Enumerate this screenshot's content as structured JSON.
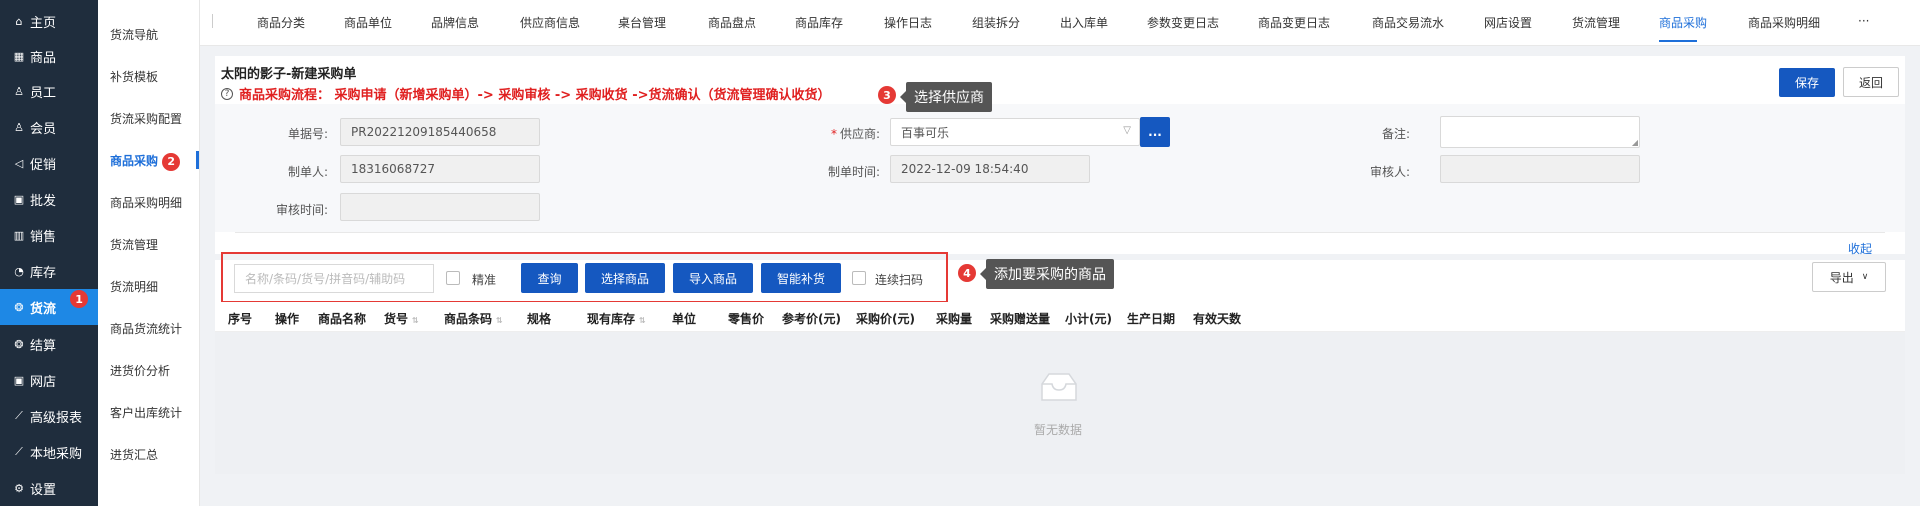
{
  "sidebar": {
    "items": [
      {
        "label": "主页",
        "icon": "home-icon"
      },
      {
        "label": "商品",
        "icon": "product-icon"
      },
      {
        "label": "员工",
        "icon": "staff-icon"
      },
      {
        "label": "会员",
        "icon": "member-icon"
      },
      {
        "label": "促销",
        "icon": "promotion-icon"
      },
      {
        "label": "批发",
        "icon": "wholesale-icon"
      },
      {
        "label": "销售",
        "icon": "sales-icon"
      },
      {
        "label": "库存",
        "icon": "stock-icon"
      },
      {
        "label": "货流",
        "icon": "flow-icon",
        "active": true,
        "badge": "1"
      },
      {
        "label": "结算",
        "icon": "settle-icon"
      },
      {
        "label": "网店",
        "icon": "shop-icon"
      },
      {
        "label": "高级报表",
        "icon": "report-icon"
      },
      {
        "label": "本地采购",
        "icon": "purchase-icon"
      },
      {
        "label": "设置",
        "icon": "settings-icon"
      }
    ]
  },
  "submenu": {
    "items": [
      {
        "label": "货流导航"
      },
      {
        "label": "补货模板"
      },
      {
        "label": "货流采购配置"
      },
      {
        "label": "商品采购",
        "active": true,
        "badge": "2"
      },
      {
        "label": "商品采购明细"
      },
      {
        "label": "货流管理"
      },
      {
        "label": "货流明细"
      },
      {
        "label": "商品货流统计"
      },
      {
        "label": "进货价分析"
      },
      {
        "label": "客户出库统计"
      },
      {
        "label": "进货汇总"
      }
    ]
  },
  "tabs": [
    {
      "label": "商品分类"
    },
    {
      "label": "商品单位"
    },
    {
      "label": "品牌信息"
    },
    {
      "label": "供应商信息"
    },
    {
      "label": "桌台管理"
    },
    {
      "label": "商品盘点"
    },
    {
      "label": "商品库存"
    },
    {
      "label": "操作日志"
    },
    {
      "label": "组装拆分"
    },
    {
      "label": "出入库单"
    },
    {
      "label": "参数变更日志"
    },
    {
      "label": "商品变更日志"
    },
    {
      "label": "商品交易流水"
    },
    {
      "label": "网店设置"
    },
    {
      "label": "货流管理"
    },
    {
      "label": "商品采购",
      "active": true
    },
    {
      "label": "商品采购明细"
    },
    {
      "label": "···"
    }
  ],
  "page": {
    "title": "太阳的影子-新建采购单",
    "flow": "商品采购流程： 采购申请（新增采购单）-> 采购审核 -> 采购收货 ->货流确认（货流管理确认收货）",
    "save": "保存",
    "back": "返回",
    "collapse": "收起",
    "export": "导出"
  },
  "form": {
    "order_no_label": "单据号:",
    "order_no": "PR20221209185440658",
    "supplier_label": "供应商:",
    "supplier": "百事可乐",
    "supplier_btn": "...",
    "remark_label": "备注:",
    "creator_label": "制单人:",
    "creator": "18316068727",
    "create_time_label": "制单时间:",
    "create_time": "2022-12-09 18:54:40",
    "auditor_label": "审核人:",
    "audit_time_label": "审核时间:"
  },
  "annotations": {
    "tip3_badge": "3",
    "tip3": "选择供应商",
    "tip4_badge": "4",
    "tip4": "添加要采购的商品"
  },
  "toolbar": {
    "search_placeholder": "名称/条码/货号/拼音码/辅助码",
    "exact": "精准",
    "query": "查询",
    "select_goods": "选择商品",
    "import_goods": "导入商品",
    "smart_restock": "智能补货",
    "continuous_scan": "连续扫码"
  },
  "table": {
    "columns": [
      "序号",
      "操作",
      "商品名称",
      "货号",
      "商品条码",
      "规格",
      "现有库存",
      "单位",
      "零售价",
      "参考价(元)",
      "采购价(元)",
      "采购量",
      "采购赠送量",
      "小计(元)",
      "生产日期",
      "有效天数"
    ],
    "empty_text": "暂无数据"
  },
  "colors": {
    "primary": "#1558c0",
    "sidebar_bg": "#1f2d3d",
    "active_blue": "#1e88e5",
    "alert_red": "#e02020"
  }
}
